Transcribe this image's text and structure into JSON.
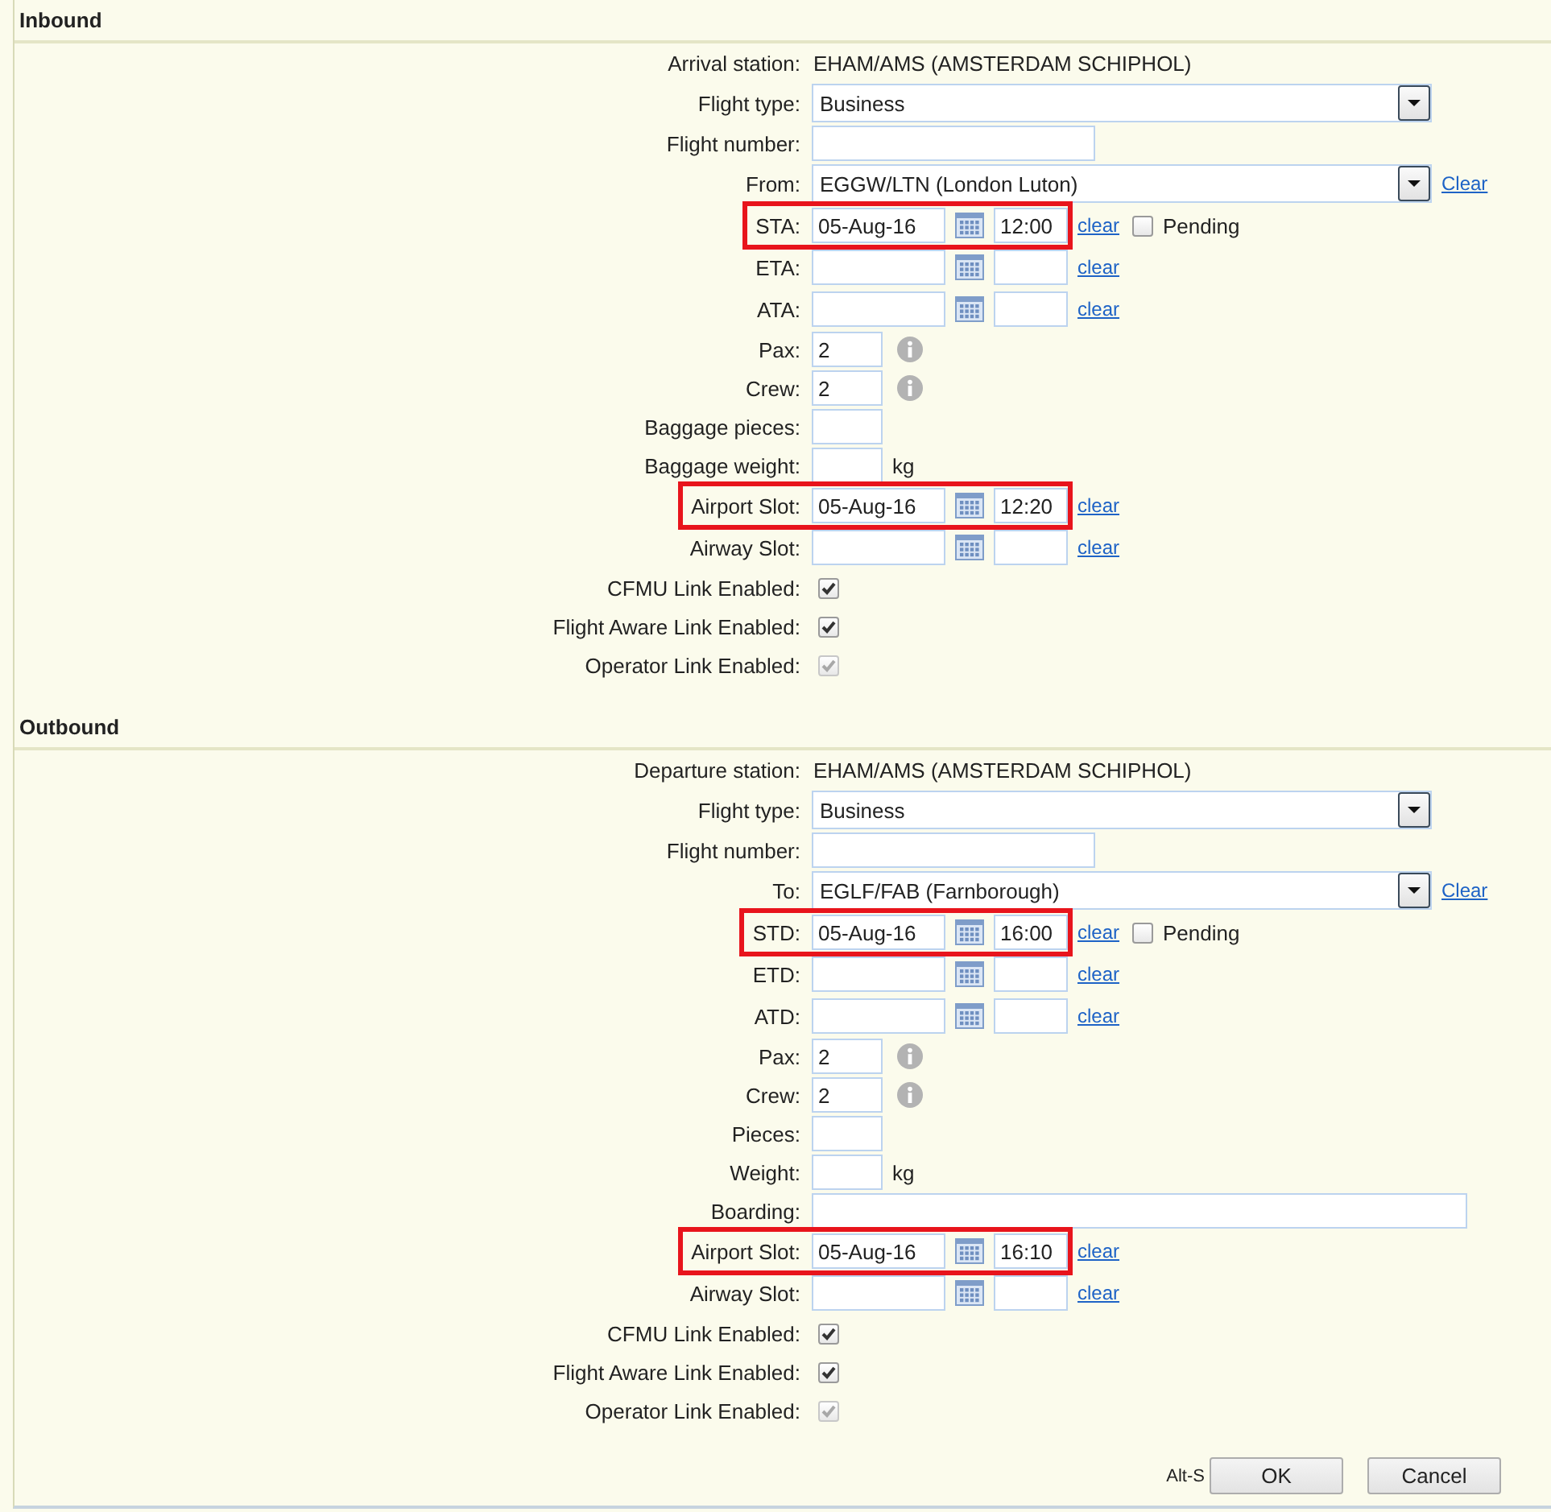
{
  "sections": [
    {
      "title": "Inbound",
      "rows": [
        {
          "kind": "text",
          "label": "Arrival station:",
          "value": "EHAM/AMS (AMSTERDAM SCHIPHOL)"
        },
        {
          "kind": "select",
          "label": "Flight type:",
          "value": "Business"
        },
        {
          "kind": "input",
          "label": "Flight number:"
        },
        {
          "kind": "select",
          "label": "From:",
          "value": "EGGW/LTN (London Luton)",
          "link": "Clear"
        },
        {
          "kind": "datetime",
          "label": "STA:",
          "date": "05-Aug-16",
          "time": "12:00",
          "link": "clear",
          "pending": {
            "label": "Pending",
            "checked": false
          },
          "highlighted": true
        },
        {
          "kind": "datetime",
          "label": "ETA:",
          "link": "clear",
          "highlighted": false
        },
        {
          "kind": "datetime",
          "label": "ATA:",
          "link": "clear",
          "highlighted": false
        },
        {
          "kind": "short_input",
          "label": "Pax:",
          "value": "2",
          "info": true
        },
        {
          "kind": "short_input",
          "label": "Crew:",
          "value": "2",
          "info": true
        },
        {
          "kind": "short_input",
          "label": "Baggage pieces:"
        },
        {
          "kind": "short_input",
          "label": "Baggage weight:",
          "unit": "kg"
        },
        {
          "kind": "datetime",
          "label": "Airport Slot:",
          "date": "05-Aug-16",
          "time": "12:20",
          "link": "clear",
          "highlighted": true
        },
        {
          "kind": "datetime",
          "label": "Airway Slot:",
          "link": "clear",
          "highlighted": false
        },
        {
          "kind": "checkbox",
          "label": "CFMU Link Enabled:",
          "checked": true,
          "disabled": false
        },
        {
          "kind": "checkbox",
          "label": "Flight Aware Link Enabled:",
          "checked": true,
          "disabled": false
        },
        {
          "kind": "checkbox",
          "label": "Operator Link Enabled:",
          "checked": true,
          "disabled": true
        }
      ]
    },
    {
      "title": "Outbound",
      "rows": [
        {
          "kind": "text",
          "label": "Departure station:",
          "value": "EHAM/AMS (AMSTERDAM SCHIPHOL)"
        },
        {
          "kind": "select",
          "label": "Flight type:",
          "value": "Business"
        },
        {
          "kind": "input",
          "label": "Flight number:"
        },
        {
          "kind": "select",
          "label": "To:",
          "value": "EGLF/FAB (Farnborough)",
          "link": "Clear"
        },
        {
          "kind": "datetime",
          "label": "STD:",
          "date": "05-Aug-16",
          "time": "16:00",
          "link": "clear",
          "pending": {
            "label": "Pending",
            "checked": false
          },
          "highlighted": true
        },
        {
          "kind": "datetime",
          "label": "ETD:",
          "link": "clear",
          "highlighted": false
        },
        {
          "kind": "datetime",
          "label": "ATD:",
          "link": "clear",
          "highlighted": false
        },
        {
          "kind": "short_input",
          "label": "Pax:",
          "value": "2",
          "info": true
        },
        {
          "kind": "short_input",
          "label": "Crew:",
          "value": "2",
          "info": true
        },
        {
          "kind": "short_input",
          "label": "Pieces:"
        },
        {
          "kind": "short_input",
          "label": "Weight:",
          "unit": "kg"
        },
        {
          "kind": "long_input",
          "label": "Boarding:"
        },
        {
          "kind": "datetime",
          "label": "Airport Slot:",
          "date": "05-Aug-16",
          "time": "16:10",
          "link": "clear",
          "highlighted": true
        },
        {
          "kind": "datetime",
          "label": "Airway Slot:",
          "link": "clear",
          "highlighted": false
        },
        {
          "kind": "checkbox",
          "label": "CFMU Link Enabled:",
          "checked": true,
          "disabled": false
        },
        {
          "kind": "checkbox",
          "label": "Flight Aware Link Enabled:",
          "checked": true,
          "disabled": false
        },
        {
          "kind": "checkbox",
          "label": "Operator Link Enabled:",
          "checked": true,
          "disabled": true
        }
      ]
    }
  ],
  "footer": {
    "shortcut": "Alt-S",
    "buttons": [
      {
        "label": "OK"
      },
      {
        "label": "Cancel"
      }
    ]
  }
}
